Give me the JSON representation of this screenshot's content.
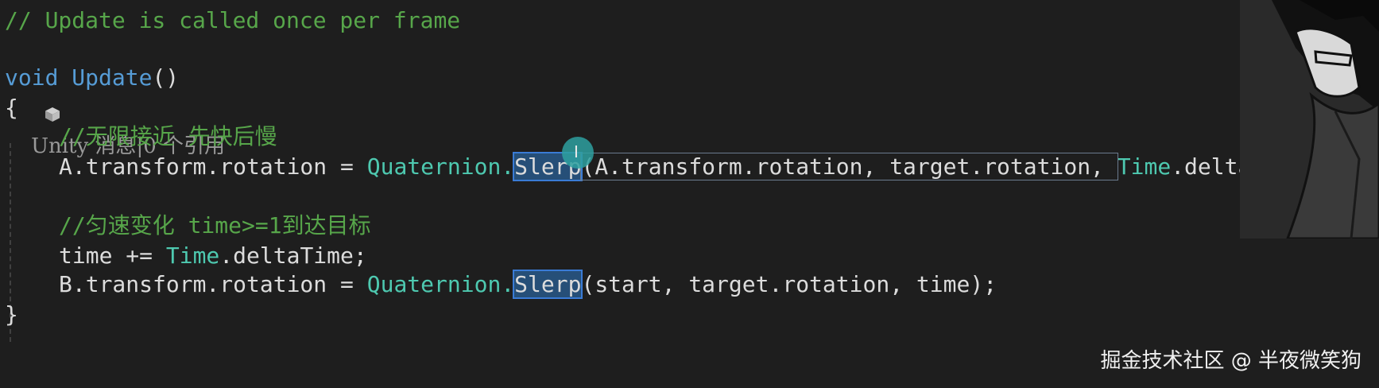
{
  "editor": {
    "comment_update": "// Update is called once per frame",
    "codelens_unity": "Unity 消息",
    "codelens_sep": "|",
    "codelens_refs": "0 个引用",
    "kw_void": "void",
    "fn_update": "Update",
    "parens": "()",
    "brace_open": "{",
    "comment_lerp1": "//无限接近 先快后慢",
    "line_a_lhs": "A.transform.rotation = ",
    "quaternion": "Quaternion",
    "dot": ".",
    "slerp": "Slerp",
    "line_a_args1": "(A.transform.rotation, target.rotation, ",
    "time_type": "Time",
    "line_a_args2": ".deltaTime",
    "close_paren": ")",
    "semicolon": ";",
    "comment_lerp2": "//匀速变化 time>=1到达目标",
    "line_time_lhs": "time += ",
    "line_time_rhs": ".deltaTime;",
    "line_b_lhs": "B.transform.rotation = ",
    "line_b_args": "(start, target.rotation, time);",
    "brace_close": "}"
  },
  "watermark": "掘金技术社区 @ 半夜微笑狗",
  "colors": {
    "background": "#1e1e1e",
    "comment": "#57a64a",
    "keyword": "#569cd6",
    "type": "#4ec9b0",
    "text": "#dcdcdc",
    "selection": "#264f78"
  }
}
